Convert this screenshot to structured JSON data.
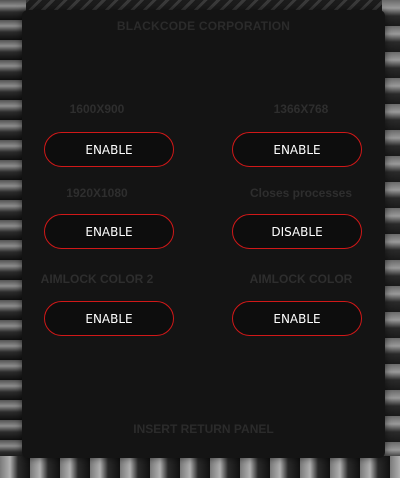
{
  "panel": {
    "title": "BLACKCODE CORPORATION",
    "footer": "INSERT RETURN PANEL"
  },
  "options": [
    {
      "label": "1600X900",
      "button": "ENABLE"
    },
    {
      "label": "1366X768",
      "button": "ENABLE"
    },
    {
      "label": "1920X1080",
      "button": "ENABLE"
    },
    {
      "label": "Closes processes",
      "button": "DISABLE"
    },
    {
      "label": "AIMLOCK COLOR 2",
      "button": "ENABLE"
    },
    {
      "label": "AIMLOCK COLOR",
      "button": "ENABLE"
    }
  ],
  "colors": {
    "accent": "#d01818",
    "panel_bg": "#141414",
    "label_text": "#2e2e2e"
  }
}
